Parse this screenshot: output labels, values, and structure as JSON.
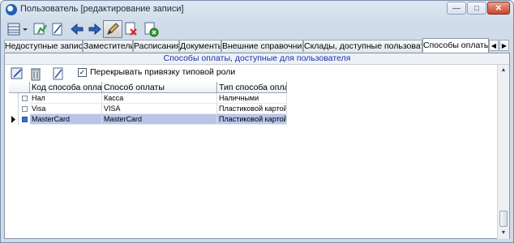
{
  "window": {
    "title": "Пользователь [редактирование записи]",
    "controls": {
      "minimize": "—",
      "maximize": "□",
      "close": "✕"
    }
  },
  "toolbar": {
    "tools": [
      {
        "icon": "grid-settings-icon"
      },
      {
        "icon": "save-icon"
      },
      {
        "icon": "edit-document-icon"
      },
      {
        "icon": "arrow-left-icon"
      },
      {
        "icon": "arrow-right-icon"
      },
      {
        "icon": "pen-icon"
      },
      {
        "icon": "delete-icon"
      },
      {
        "icon": "close-document-icon"
      }
    ]
  },
  "tabs": {
    "items": [
      {
        "label": "Недоступные записи"
      },
      {
        "label": "Заместители"
      },
      {
        "label": "Расписания"
      },
      {
        "label": "Документы"
      },
      {
        "label": "Внешние справочники"
      },
      {
        "label": "Склады, доступные пользователю"
      },
      {
        "label": "Способы оплаты"
      }
    ],
    "selected_index": 6,
    "scroll_left": "◀",
    "scroll_right": "▶"
  },
  "section": {
    "header": "Способы оплаты, доступные для пользователя",
    "override_checkbox": {
      "label": "Перекрывать привязку типовой роли",
      "checked": true,
      "mark": "✓"
    }
  },
  "grid": {
    "columns": [
      "Код способа оплаты",
      "Способ оплаты",
      "Тип способа оплаты"
    ],
    "rows": [
      {
        "code": "Нал",
        "name": "Касса",
        "type": "Наличными",
        "checked": false,
        "selected": false
      },
      {
        "code": "Visa",
        "name": "VISA",
        "type": "Пластиковой картой",
        "checked": false,
        "selected": false
      },
      {
        "code": "MasterCard",
        "name": "MasterCard",
        "type": "Пластиковой картой",
        "checked": true,
        "selected": true
      }
    ]
  },
  "colors": {
    "selection": "#b9c4e9",
    "header_text": "#1a2fb0"
  }
}
